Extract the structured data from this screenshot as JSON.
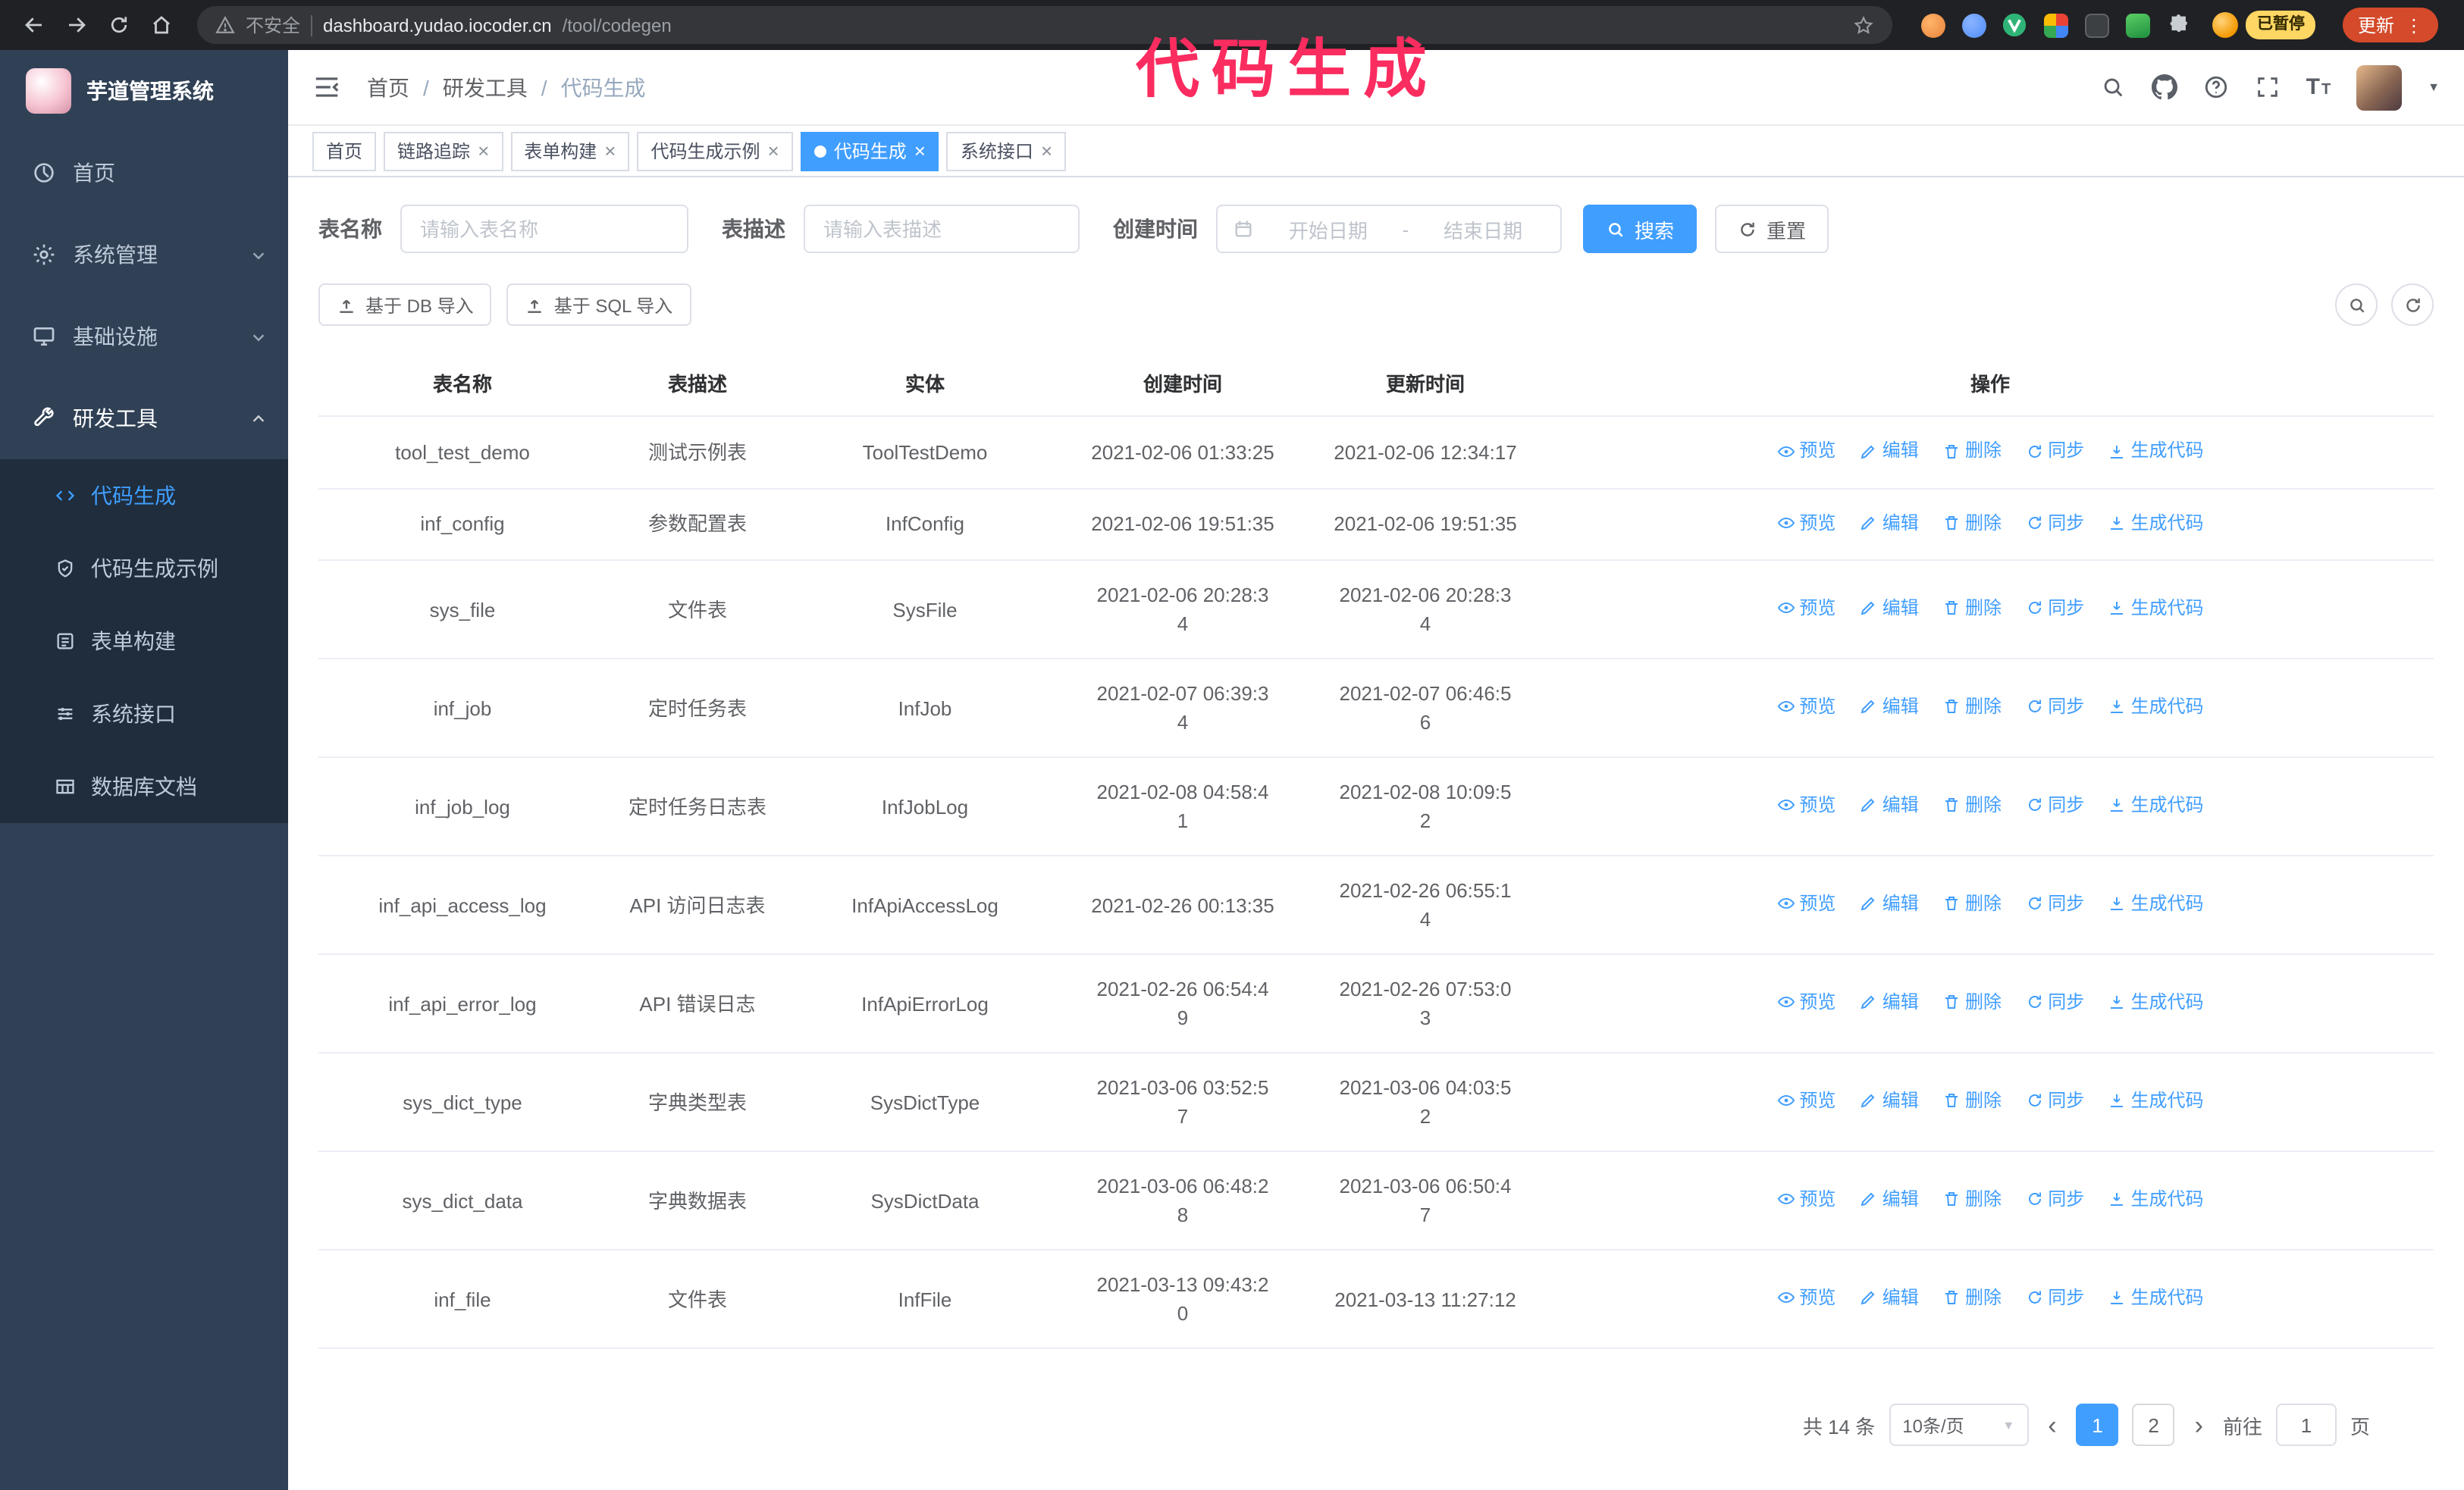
{
  "colors": {
    "accent": "#409eff",
    "link": "#409eff",
    "sidebar-bg": "#304156",
    "submenu-bg": "#1f2d3d",
    "sidebar-text": "#bfcbd9",
    "annotation": "#fb2c5f",
    "browser-bg": "#202124",
    "paused-badge-bg": "#fdd663",
    "update-pill-bg": "#d44a2a"
  },
  "glyphs": {
    "close": "×",
    "slash": "/",
    "caret_down": "▼",
    "prev": "‹",
    "next": "›",
    "kebab": "⋮",
    "font_t": "T"
  },
  "browser": {
    "security_label": "不安全",
    "url_host": "dashboard.yudao.iocoder.cn",
    "url_path": "/tool/codegen",
    "paused_badge": "已暂停",
    "update_button": "更新"
  },
  "annotation": {
    "text": "代码生成"
  },
  "sidebar": {
    "title": "芋道管理系统",
    "items": [
      {
        "label": "首页"
      },
      {
        "label": "系统管理"
      },
      {
        "label": "基础设施"
      },
      {
        "label": "研发工具"
      }
    ],
    "subitems": [
      {
        "label": "代码生成"
      },
      {
        "label": "代码生成示例"
      },
      {
        "label": "表单构建"
      },
      {
        "label": "系统接口"
      },
      {
        "label": "数据库文档"
      }
    ]
  },
  "header": {
    "breadcrumb": [
      "首页",
      "研发工具",
      "代码生成"
    ]
  },
  "tabs": [
    {
      "label": "首页"
    },
    {
      "label": "链路追踪"
    },
    {
      "label": "表单构建"
    },
    {
      "label": "代码生成示例"
    },
    {
      "label": "代码生成"
    },
    {
      "label": "系统接口"
    }
  ],
  "filters": {
    "table_name_label": "表名称",
    "table_name_placeholder": "请输入表名称",
    "table_desc_label": "表描述",
    "table_desc_placeholder": "请输入表描述",
    "create_time_label": "创建时间",
    "date_start_placeholder": "开始日期",
    "date_separator": "-",
    "date_end_placeholder": "结束日期",
    "search_button": "搜索",
    "reset_button": "重置"
  },
  "toolbar": {
    "import_db": "基于 DB 导入",
    "import_sql": "基于 SQL 导入"
  },
  "table": {
    "columns": [
      "表名称",
      "表描述",
      "实体",
      "创建时间",
      "更新时间",
      "操作"
    ],
    "actions": [
      "预览",
      "编辑",
      "删除",
      "同步",
      "生成代码"
    ],
    "rows": [
      {
        "name": "tool_test_demo",
        "desc": "测试示例表",
        "entity": "ToolTestDemo",
        "created": "2021-02-06 01:33:25",
        "updated": "2021-02-06 12:34:17"
      },
      {
        "name": "inf_config",
        "desc": "参数配置表",
        "entity": "InfConfig",
        "created": "2021-02-06 19:51:35",
        "updated": "2021-02-06 19:51:35"
      },
      {
        "name": "sys_file",
        "desc": "文件表",
        "entity": "SysFile",
        "created": "2021-02-06 20:28:3\n4",
        "updated": "2021-02-06 20:28:3\n4"
      },
      {
        "name": "inf_job",
        "desc": "定时任务表",
        "entity": "InfJob",
        "created": "2021-02-07 06:39:3\n4",
        "updated": "2021-02-07 06:46:5\n6"
      },
      {
        "name": "inf_job_log",
        "desc": "定时任务日志表",
        "entity": "InfJobLog",
        "created": "2021-02-08 04:58:4\n1",
        "updated": "2021-02-08 10:09:5\n2"
      },
      {
        "name": "inf_api_access_log",
        "desc": "API 访问日志表",
        "entity": "InfApiAccessLog",
        "created": "2021-02-26 00:13:35",
        "updated": "2021-02-26 06:55:1\n4"
      },
      {
        "name": "inf_api_error_log",
        "desc": "API 错误日志",
        "entity": "InfApiErrorLog",
        "created": "2021-02-26 06:54:4\n9",
        "updated": "2021-02-26 07:53:0\n3"
      },
      {
        "name": "sys_dict_type",
        "desc": "字典类型表",
        "entity": "SysDictType",
        "created": "2021-03-06 03:52:5\n7",
        "updated": "2021-03-06 04:03:5\n2"
      },
      {
        "name": "sys_dict_data",
        "desc": "字典数据表",
        "entity": "SysDictData",
        "created": "2021-03-06 06:48:2\n8",
        "updated": "2021-03-06 06:50:4\n7"
      },
      {
        "name": "inf_file",
        "desc": "文件表",
        "entity": "InfFile",
        "created": "2021-03-13 09:43:2\n0",
        "updated": "2021-03-13 11:27:12"
      }
    ]
  },
  "pagination": {
    "total": "共 14 条",
    "page_size": "10条/页",
    "page_1": "1",
    "page_2": "2",
    "goto_label": "前往",
    "goto_value": "1",
    "unit_label": "页"
  }
}
